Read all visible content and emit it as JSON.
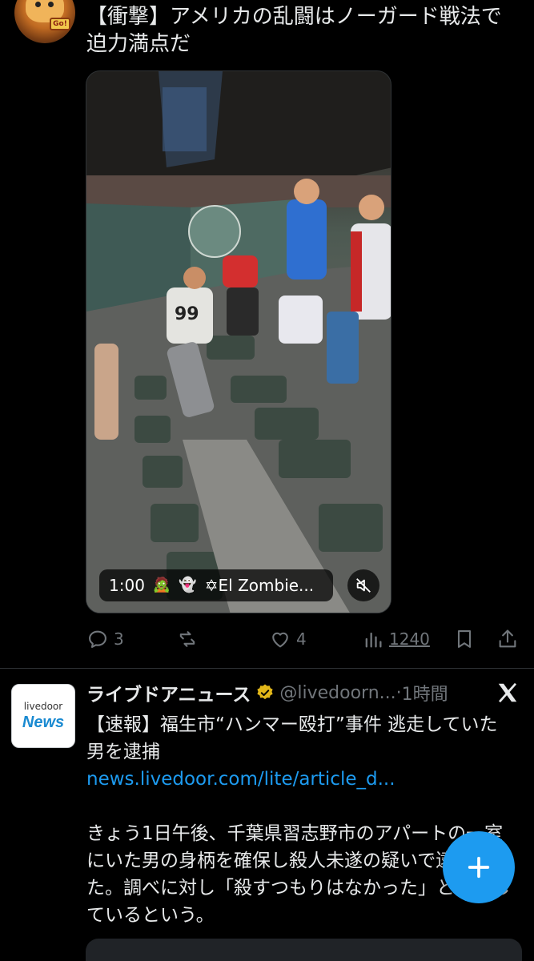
{
  "tweet1": {
    "text": "【衝撃】アメリカの乱闘はノーガード戦法で迫力満点だ",
    "avatar_badge": "Go!",
    "video": {
      "duration": "1:00",
      "emoji_1": "🧟",
      "emoji_2": "👻",
      "username": "✡El Zombie...",
      "jersey_number": "99"
    },
    "actions": {
      "reply_count": "3",
      "retweet_count": "",
      "like_count": "4",
      "views_count": "1240"
    }
  },
  "tweet2": {
    "avatar_line1": "livedoor",
    "avatar_line2": "News",
    "name": "ライブドアニュース",
    "handle": "@livedoorn...",
    "time_sep": "·",
    "time": "1時間",
    "line1": "【速報】福生市“ハンマー殴打”事件 逃走していた男を逮捕",
    "link": "news.livedoor.com/lite/article_d...",
    "para": "きょう1日午後、千葉県習志野市のアパートの一室にいた男の身柄を確保し殺人未遂の疑いで逮捕した。調べに対し「殺すつもりはなかった」と供述しているという。"
  },
  "colors": {
    "background": "#000000",
    "text": "#e7e9ea",
    "muted": "#71767b",
    "accent": "#1d9bf0",
    "verified_gold": "#e2b719"
  },
  "icons": [
    "reply-icon",
    "retweet-icon",
    "like-icon",
    "views-icon",
    "bookmark-icon",
    "share-icon",
    "mute-icon",
    "verified-badge-icon",
    "x-logo-icon",
    "compose-plus-icon"
  ]
}
